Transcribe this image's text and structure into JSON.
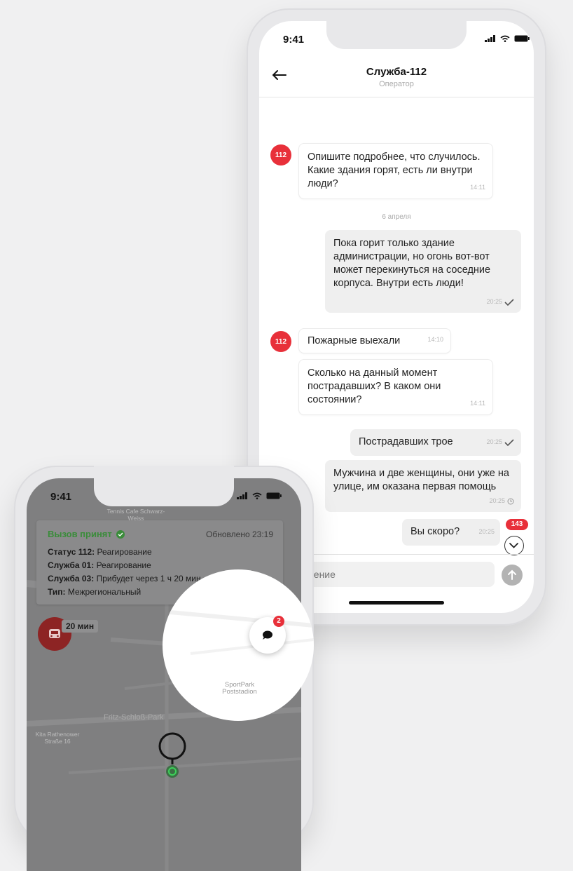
{
  "chat_phone": {
    "status_time": "9:41",
    "header": {
      "title": "Служба-112",
      "subtitle": "Оператор"
    },
    "messages": [
      {
        "sender": "112",
        "text": "Опишите подробнее, что случилось. Какие здания горят, есть ли внутри люди?",
        "time": "14:11"
      },
      {
        "date_separator": "6 апреля"
      },
      {
        "sender": "me",
        "text": "Пока горит только здание администрации, но огонь вот-вот может перекинуться на соседние корпуса. Внутри есть люди!",
        "time": "20:25"
      },
      {
        "sender": "112",
        "text": "Пожарные выехали",
        "time": "14:10"
      },
      {
        "sender": "112",
        "text": "Сколько на данный момент пострадавших? В каком они состоянии?",
        "time": "14:11"
      },
      {
        "sender": "me",
        "text": "Пострадавших трое",
        "time": "20:25"
      },
      {
        "sender": "me",
        "text": "Мужчина и две женщины, они уже на улице, им оказана первая помощь",
        "time": "20:25"
      },
      {
        "sender": "me",
        "text": "Вы скоро?",
        "time": "20:25"
      }
    ],
    "unread_count": "143",
    "input_placeholder": "е сообщение",
    "avatar_label": "112"
  },
  "map_phone": {
    "status_time": "9:41",
    "card": {
      "title": "Вызов принят",
      "updated": "Обновлено 23:19",
      "rows": [
        {
          "label": "Статус 112:",
          "value": "Реагирование"
        },
        {
          "label": "Служба 01:",
          "value": "Реагирование"
        },
        {
          "label": "Служба 03:",
          "value": "Прибудет через 1 ч 20 мин"
        },
        {
          "label": "Тип:",
          "value": "Межрегиональный"
        }
      ]
    },
    "eta": "20 мин",
    "chat_badge": "2",
    "map_labels": {
      "cafe": "Tennis Cafe Schwarz-Weiss",
      "sportpark": "SportPark Poststadion",
      "street": "Fritz-Schloß-Park",
      "kita": "Kita Rathenower Straße 16"
    }
  },
  "colors": {
    "accent_red": "#e8303a",
    "accept_green": "#3a8c3a"
  }
}
